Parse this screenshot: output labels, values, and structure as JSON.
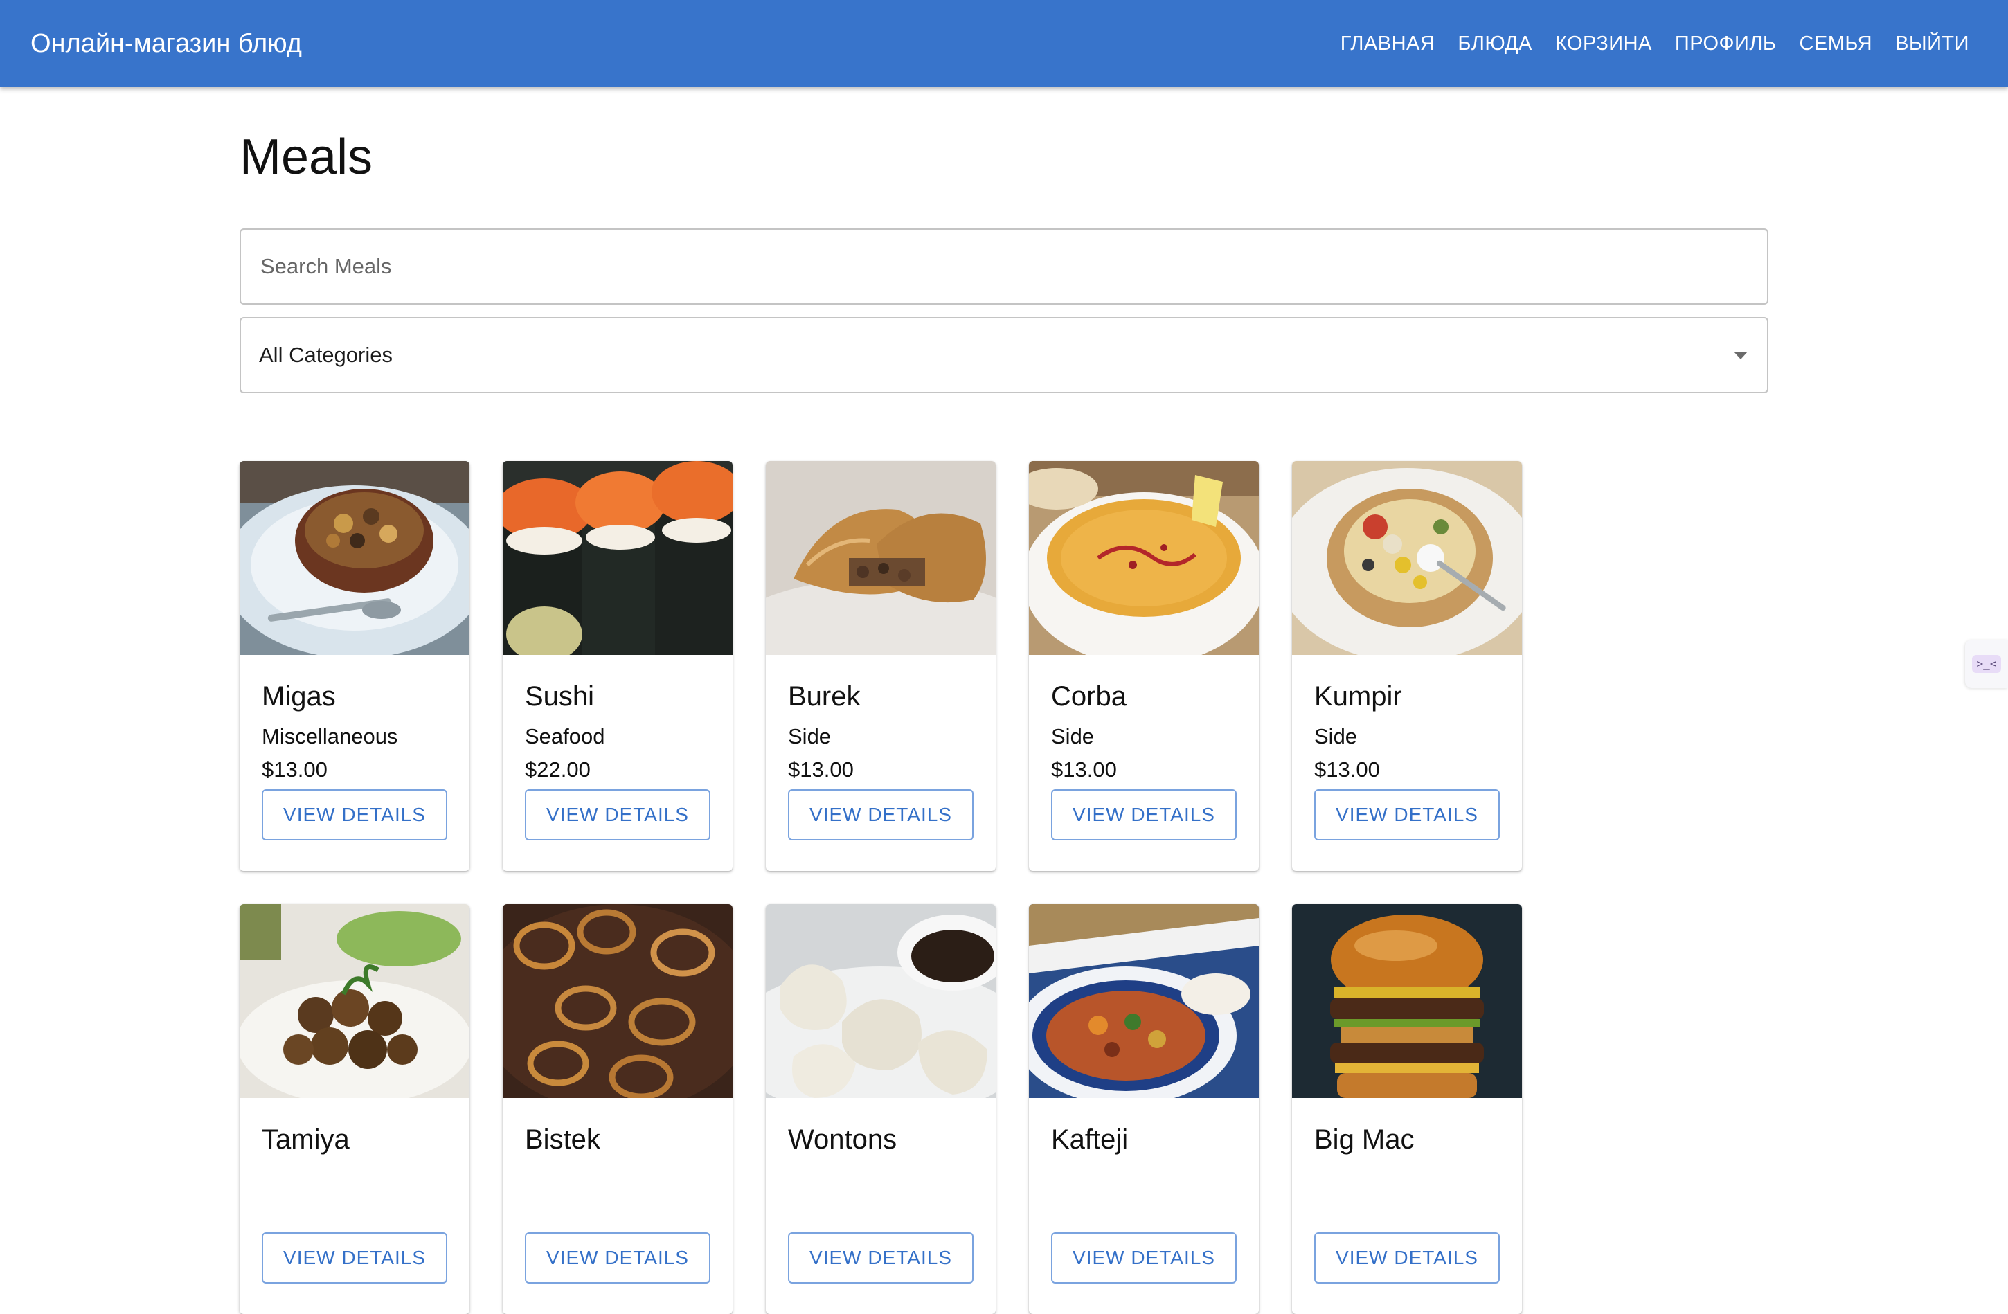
{
  "header": {
    "title": "Онлайн-магазин блюд",
    "nav": [
      "ГЛАВНАЯ",
      "БЛЮДА",
      "КОРЗИНА",
      "ПРОФИЛЬ",
      "СЕМЬЯ",
      "ВЫЙТИ"
    ]
  },
  "page": {
    "title": "Meals",
    "search_placeholder": "Search Meals",
    "category_selected": "All Categories",
    "view_details_label": "VIEW DETAILS"
  },
  "meals": [
    {
      "name": "Migas",
      "category": "Miscellaneous",
      "price": "$13.00"
    },
    {
      "name": "Sushi",
      "category": "Seafood",
      "price": "$22.00"
    },
    {
      "name": "Burek",
      "category": "Side",
      "price": "$13.00"
    },
    {
      "name": "Corba",
      "category": "Side",
      "price": "$13.00"
    },
    {
      "name": "Kumpir",
      "category": "Side",
      "price": "$13.00"
    },
    {
      "name": "Tamiya",
      "category": "",
      "price": ""
    },
    {
      "name": "Bistek",
      "category": "",
      "price": ""
    },
    {
      "name": "Wontons",
      "category": "",
      "price": ""
    },
    {
      "name": "Kafteji",
      "category": "",
      "price": ""
    },
    {
      "name": "Big Mac",
      "category": "",
      "price": ""
    }
  ],
  "colors": {
    "appbar": "#3874cb",
    "button_text": "#3470c8",
    "button_border": "#7aa3df"
  }
}
